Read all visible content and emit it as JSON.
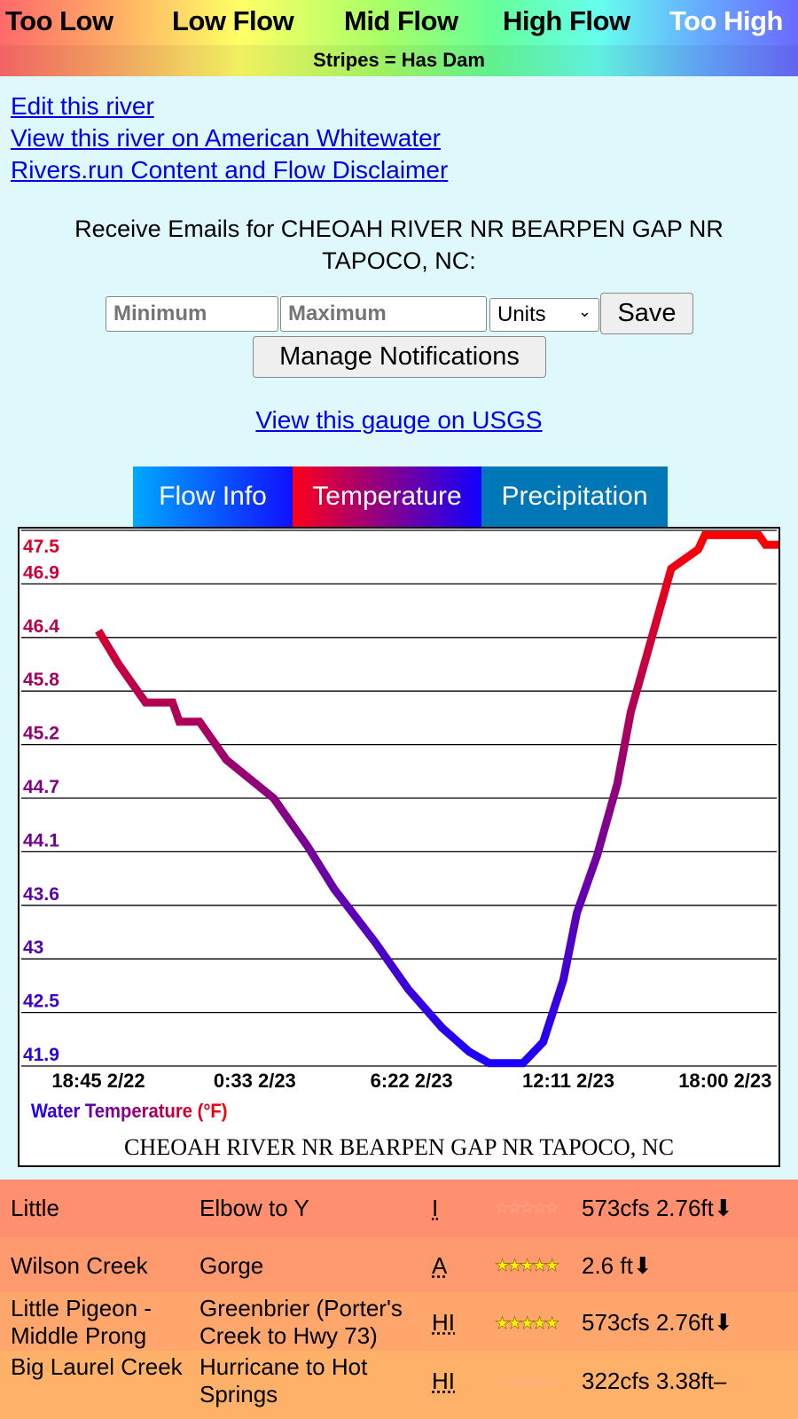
{
  "legend": {
    "too_low": "Too Low",
    "low_flow": "Low Flow",
    "mid_flow": "Mid Flow",
    "high_flow": "High Flow",
    "too_high": "Too High",
    "dam_note": "Stripes = Has Dam"
  },
  "links": {
    "edit": "Edit this river",
    "aw": "View this river on American Whitewater",
    "disclaimer": "Rivers.run Content and Flow Disclaimer"
  },
  "email": {
    "text": "Receive Emails for CHEOAH RIVER NR BEARPEN GAP NR TAPOCO, NC:",
    "min_placeholder": "Minimum",
    "max_placeholder": "Maximum",
    "units": "Units",
    "save": "Save",
    "manage": "Manage Notifications"
  },
  "usgs_link": "View this gauge on USGS",
  "tabs": [
    {
      "label": "Flow Info"
    },
    {
      "label": "Temperature",
      "active": true
    },
    {
      "label": "Precipitation"
    }
  ],
  "chart_data": {
    "type": "line",
    "title": "CHEOAH RIVER NR BEARPEN GAP NR TAPOCO, NC",
    "series": [
      {
        "name": "Water Temperature (°F)",
        "points": [
          [
            "2/22 18:45",
            46.45
          ],
          [
            "2/22 19:30",
            46.1
          ],
          [
            "2/22 20:30",
            45.7
          ],
          [
            "2/22 21:30",
            45.7
          ],
          [
            "2/22 21:45",
            45.5
          ],
          [
            "2/22 22:30",
            45.5
          ],
          [
            "2/22 23:00",
            45.3
          ],
          [
            "2/22 23:30",
            45.1
          ],
          [
            "2/23 01:15",
            44.7
          ],
          [
            "2/23 02:30",
            44.2
          ],
          [
            "2/23 03:30",
            43.75
          ],
          [
            "2/23 05:00",
            43.2
          ],
          [
            "2/23 06:15",
            42.7
          ],
          [
            "2/23 07:30",
            42.3
          ],
          [
            "2/23 08:30",
            42.05
          ],
          [
            "2/23 09:15",
            41.93
          ],
          [
            "2/23 10:30",
            41.93
          ],
          [
            "2/23 11:15",
            42.15
          ],
          [
            "2/23 12:00",
            42.8
          ],
          [
            "2/23 12:30",
            43.5
          ],
          [
            "2/23 13:15",
            44.1
          ],
          [
            "2/23 14:00",
            44.85
          ],
          [
            "2/23 14:30",
            45.6
          ],
          [
            "2/23 15:15",
            46.35
          ],
          [
            "2/23 16:00",
            47.1
          ],
          [
            "2/23 17:00",
            47.3
          ],
          [
            "2/23 17:15",
            47.45
          ],
          [
            "2/23 19:15",
            47.45
          ],
          [
            "2/23 19:30",
            47.35
          ],
          [
            "2/23 20:30",
            47.35
          ]
        ]
      }
    ],
    "yticks": [
      "47.5",
      "46.9",
      "46.4",
      "45.8",
      "45.2",
      "44.7",
      "44.1",
      "43.6",
      "43",
      "42.5",
      "41.9"
    ],
    "ylim": [
      41.9,
      47.5
    ],
    "xticks": [
      {
        "label": "18:45 2/22",
        "t": "2/22 18:45"
      },
      {
        "label": "0:33 2/23",
        "t": "2/23 00:33"
      },
      {
        "label": "6:22 2/23",
        "t": "2/23 06:22"
      },
      {
        "label": "12:11 2/23",
        "t": "2/23 12:11"
      },
      {
        "label": "18:00 2/23",
        "t": "2/23 18:00"
      }
    ],
    "grid": true,
    "colors": {
      "high": "#ff0000",
      "low": "#1a00ff"
    }
  },
  "rivers": [
    {
      "name": "Little",
      "section": "Elbow to Y",
      "class": "I",
      "stars": "☆☆☆☆☆",
      "rated": false,
      "flow": "573cfs 2.76ft",
      "trend": "⬇"
    },
    {
      "name": "Wilson Creek",
      "section": "Gorge",
      "class": "A",
      "stars": "★★★★★",
      "rated": true,
      "flow": "2.6 ft",
      "trend": "⬇"
    },
    {
      "name": "Little Pigeon - Middle Prong",
      "section": "Greenbrier (Porter's Creek to Hwy 73)",
      "class": "HI",
      "stars": "★★★★★",
      "rated": true,
      "flow": "573cfs 2.76ft",
      "trend": "⬇"
    },
    {
      "name": "Big Laurel Creek",
      "section": "Hurricane to Hot Springs",
      "class": "HI",
      "stars": "☆☆☆☆☆",
      "rated": false,
      "flow": "322cfs 3.38ft",
      "trend": "–"
    }
  ]
}
